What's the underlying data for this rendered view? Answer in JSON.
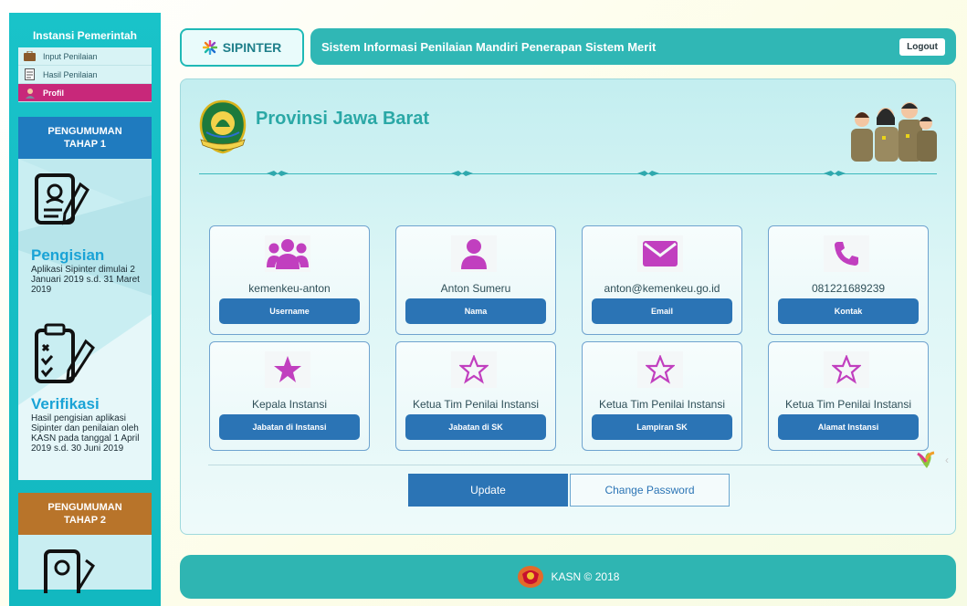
{
  "sidebar": {
    "title": "Instansi Pemerintah",
    "menu": [
      {
        "label": "Input Penilaian",
        "icon": "briefcase-icon"
      },
      {
        "label": "Hasil Penilaian",
        "icon": "document-icon"
      },
      {
        "label": "Profil",
        "icon": "user-icon"
      }
    ],
    "announcement1": {
      "line1": "PENGUMUMAN",
      "line2": "TAHAP 1",
      "steps": [
        {
          "title": "Pengisian",
          "text": "Aplikasi Sipinter dimulai 2 Januari 2019 s.d. 31 Maret 2019"
        },
        {
          "title": "Verifikasi",
          "text": "Hasil pengisian aplikasi Sipinter dan penilaian oleh KASN pada tanggal 1 April 2019 s.d. 30 Juni 2019"
        }
      ]
    },
    "announcement2": {
      "line1": "PENGUMUMAN",
      "line2": "TAHAP 2"
    }
  },
  "header": {
    "brand": "SIPINTER",
    "title": "Sistem Informasi Penilaian Mandiri Penerapan Sistem Merit",
    "logout_label": "Logout"
  },
  "main": {
    "province": "Provinsi Jawa Barat",
    "cards": [
      {
        "value": "kemenkeu-anton",
        "label": "Username",
        "icon": "users-icon"
      },
      {
        "value": "Anton Sumeru",
        "label": "Nama",
        "icon": "user-icon"
      },
      {
        "value": "anton@kemenkeu.go.id",
        "label": "Email",
        "icon": "envelope-icon"
      },
      {
        "value": "081221689239",
        "label": "Kontak",
        "icon": "phone-icon"
      },
      {
        "value": "Kepala Instansi",
        "label": "Jabatan di Instansi",
        "icon": "star-filled-icon"
      },
      {
        "value": "Ketua Tim Penilai Instansi",
        "label": "Jabatan di SK",
        "icon": "star-outline-icon"
      },
      {
        "value": "Ketua Tim Penilai Instansi",
        "label": "Lampiran SK",
        "icon": "star-outline-icon"
      },
      {
        "value": "Ketua Tim Penilai Instansi",
        "label": "Alamat Instansi",
        "icon": "star-outline-icon"
      }
    ],
    "update_label": "Update",
    "change_password_label": "Change Password"
  },
  "footer": {
    "text": "KASN © 2018"
  },
  "colors": {
    "accent": "#30b7b5",
    "button": "#2b74b5",
    "icon": "#c13fbf",
    "active": "#c8287a"
  }
}
